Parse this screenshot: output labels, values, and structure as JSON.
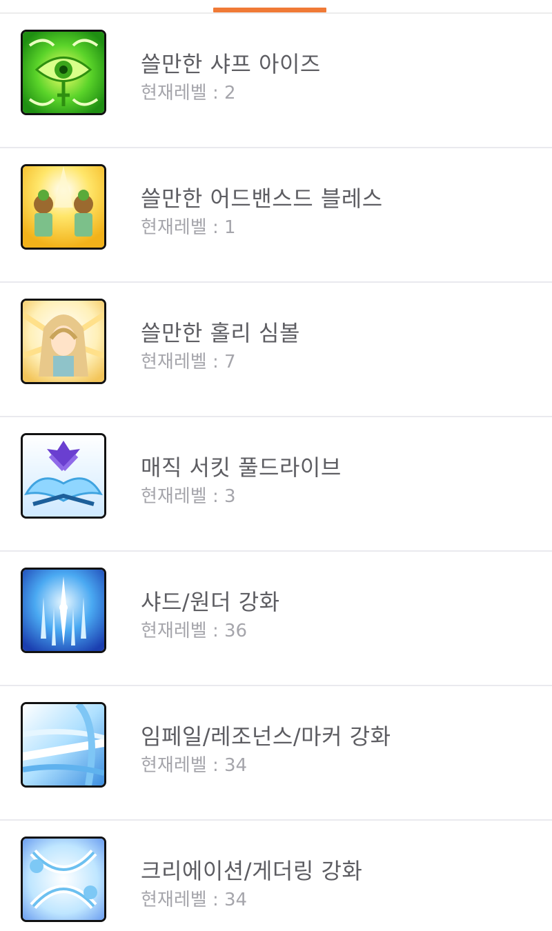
{
  "colors": {
    "accent": "#f07a36",
    "title_text": "#5d5d62",
    "sub_text": "#a5a5ab",
    "divider": "#e9e9ee"
  },
  "skills": [
    {
      "name": "쓸만한 샤프 아이즈",
      "level_label": "현재레벨 : 2",
      "icon": "sharp-eyes-icon"
    },
    {
      "name": "쓸만한 어드밴스드 블레스",
      "level_label": "현재레벨 : 1",
      "icon": "advanced-bless-icon"
    },
    {
      "name": "쓸만한 홀리 심볼",
      "level_label": "현재레벨 : 7",
      "icon": "holy-symbol-icon"
    },
    {
      "name": "매직 서킷 풀드라이브",
      "level_label": "현재레벨 : 3",
      "icon": "magic-circuit-icon"
    },
    {
      "name": "샤드/원더 강화",
      "level_label": "현재레벨 : 36",
      "icon": "shard-wonder-icon"
    },
    {
      "name": "임페일/레조넌스/마커 강화",
      "level_label": "현재레벨 : 34",
      "icon": "impale-resonance-icon"
    },
    {
      "name": "크리에이션/게더링 강화",
      "level_label": "현재레벨 : 34",
      "icon": "creation-gathering-icon"
    }
  ]
}
